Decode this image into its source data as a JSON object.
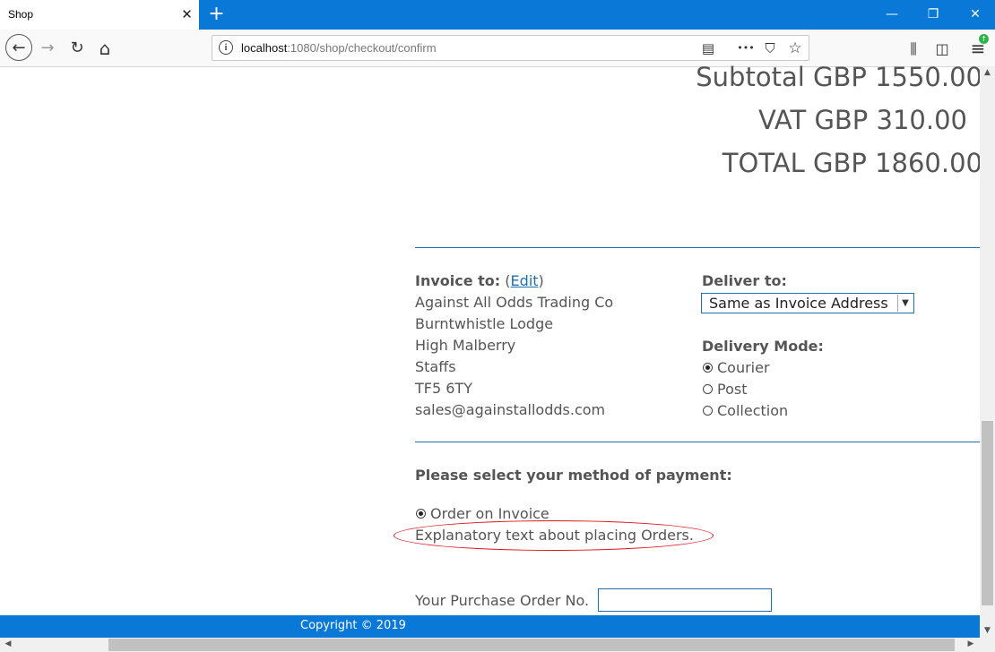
{
  "browser": {
    "tab_title": "Shop",
    "tab_close": "✕",
    "new_tab": "+",
    "window": {
      "minimize": "—",
      "restore": "❐",
      "close": "✕"
    },
    "nav": {
      "back": "←",
      "forward": "→",
      "reload": "↻",
      "home": "⌂"
    },
    "url": {
      "host": "localhost",
      "path": ":1080/shop/checkout/confirm",
      "info": "i"
    },
    "url_actions": {
      "reader": "▤",
      "more": "•••",
      "pocket": "⛉",
      "bookmark": "☆"
    },
    "toolbar": {
      "library": "⫼",
      "sidebars": "◫",
      "menu": "≡"
    }
  },
  "totals": {
    "subtotal": "Subtotal GBP 1550.00",
    "vat": "VAT GBP 310.00",
    "total": "TOTAL GBP 1860.00"
  },
  "invoice": {
    "label": "Invoice to:",
    "paren_open": "(",
    "edit_label": "Edit",
    "paren_close": ")",
    "address": [
      "Against All Odds Trading Co",
      "Burntwhistle Lodge",
      "High Malberry",
      "Staffs",
      "TF5 6TY",
      "sales@againstallodds.com"
    ]
  },
  "delivery": {
    "deliver_label": "Deliver to:",
    "selected": "Same as Invoice Address",
    "mode_label": "Delivery Mode:",
    "modes": [
      {
        "label": "Courier",
        "checked": true
      },
      {
        "label": "Post",
        "checked": false
      },
      {
        "label": "Collection",
        "checked": false
      }
    ]
  },
  "payment": {
    "heading": "Please select your method of payment:",
    "option": "Order on Invoice",
    "explanation": "Explanatory text about placing Orders.",
    "po_label": "Your Purchase Order No.",
    "po_value": ""
  },
  "footer": {
    "copyright": "Copyright © 2019"
  },
  "colors": {
    "accent": "#0a78d7",
    "rule": "#1e6fb3",
    "annotation": "#e0141e"
  }
}
